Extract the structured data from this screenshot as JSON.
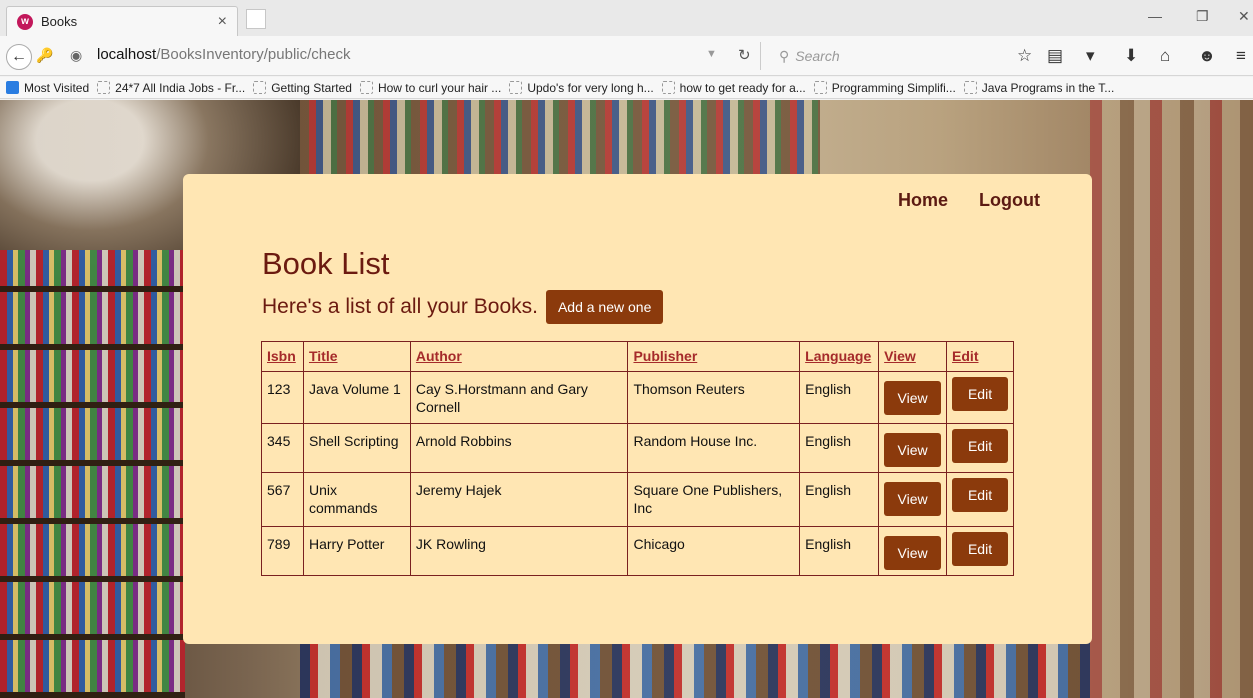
{
  "browser": {
    "tab_title": "Books",
    "tab_favicon": "w",
    "tab_close": "×",
    "url_scheme_path_host": "localhost",
    "url_path": "/BooksInventory/public/check",
    "search_placeholder": "Search",
    "window_min": "—",
    "window_restore": "❐",
    "window_close": "✕",
    "bookmarks": [
      "Most Visited",
      "24*7 All India Jobs - Fr...",
      "Getting Started",
      "How to curl your hair ...",
      "Updo's for very long h...",
      "how to get ready for a...",
      "Programming Simplifi...",
      "Java Programs in the T..."
    ]
  },
  "nav": {
    "home": "Home",
    "logout": "Logout"
  },
  "page": {
    "title": "Book List",
    "subtitle": "Here's a list of all your Books.",
    "add_button": "Add a new one"
  },
  "table": {
    "headers": [
      "Isbn",
      "Title",
      "Author",
      "Publisher",
      "Language",
      "View",
      "Edit"
    ],
    "rows": [
      {
        "isbn": "123",
        "title": "Java Volume 1",
        "author": "Cay S.Horstmann and Gary Cornell",
        "publisher": "Thomson Reuters",
        "language": "English",
        "view": "View",
        "edit": "Edit"
      },
      {
        "isbn": "345",
        "title": "Shell Scripting",
        "author": "Arnold Robbins",
        "publisher": "Random House Inc.",
        "language": "English",
        "view": "View",
        "edit": "Edit"
      },
      {
        "isbn": "567",
        "title": "Unix commands",
        "author": "Jeremy Hajek",
        "publisher": "Square One Publishers, Inc",
        "language": "English",
        "view": "View",
        "edit": "Edit"
      },
      {
        "isbn": "789",
        "title": "Harry Potter",
        "author": "JK Rowling",
        "publisher": "Chicago",
        "language": "English",
        "view": "View",
        "edit": "Edit"
      }
    ]
  },
  "colors": {
    "card_bg": "#ffe6b3",
    "accent_text": "#6b1a10",
    "button_bg": "#8b3a0c",
    "header_link": "#a52a2a"
  }
}
